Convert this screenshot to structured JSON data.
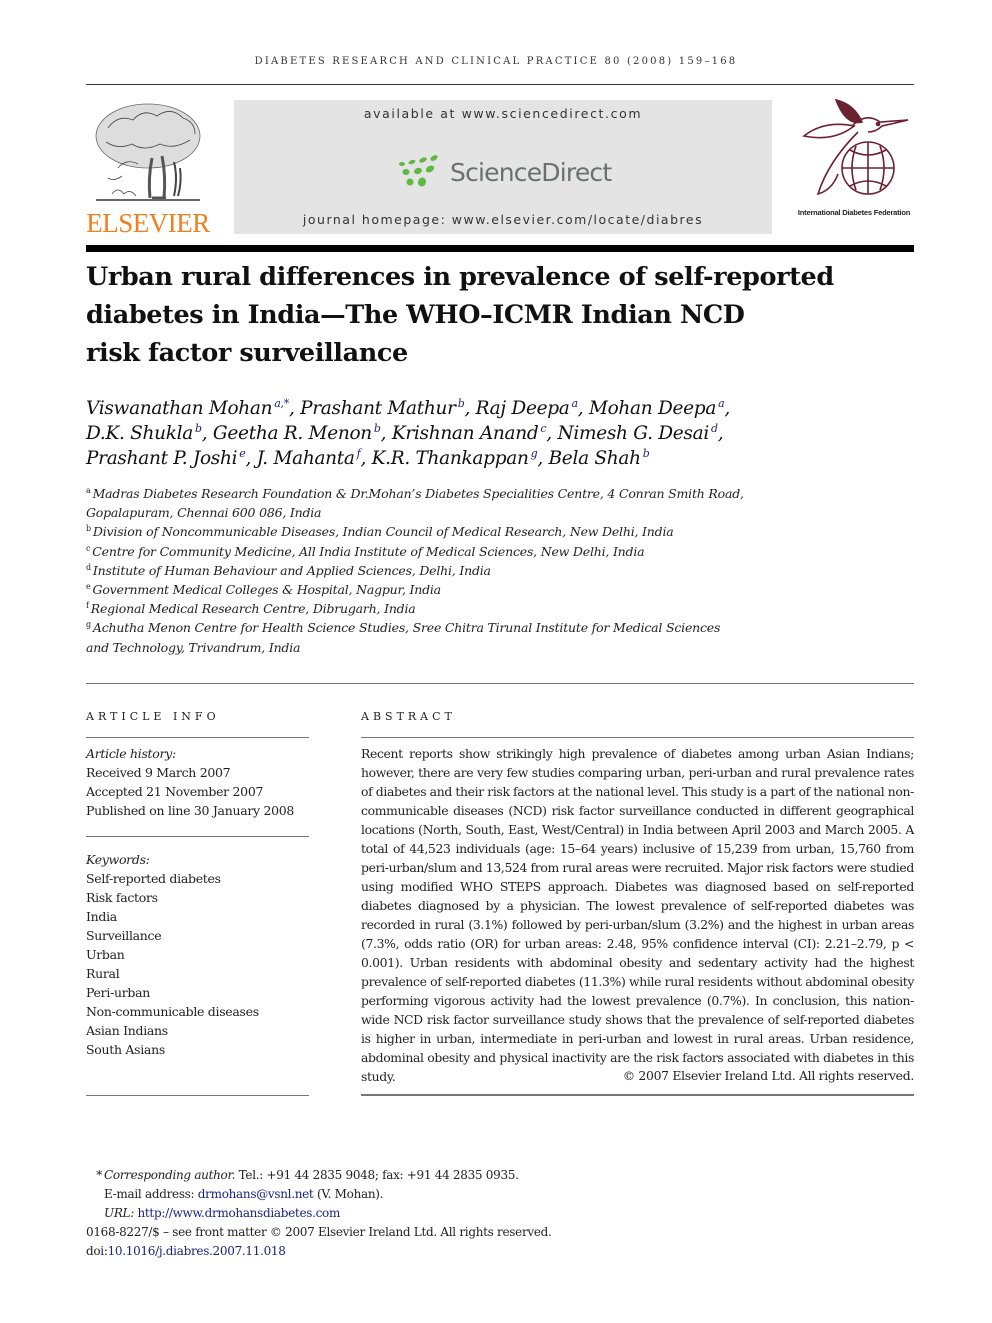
{
  "running_header": "DIABETES RESEARCH AND CLINICAL PRACTICE 80 (2008) 159–168",
  "banner": {
    "publisher_logo": "ELSEVIER",
    "available_at": "available at www.sciencedirect.com",
    "sciencedirect_logo": "ScienceDirect",
    "journal_homepage": "journal homepage: www.elsevier.com/locate/diabres",
    "society_label": "International Diabetes Federation",
    "colors": {
      "elsevier_orange": "#f07f1c",
      "sciencedirect_green": "#5fb840",
      "idf_maroon": "#6b2230"
    }
  },
  "title_lines": [
    "Urban rural differences in prevalence of self-reported",
    "diabetes in India—The WHO–ICMR Indian NCD",
    "risk factor surveillance"
  ],
  "authors": [
    {
      "name": "Viswanathan Mohan",
      "aff": "a,*"
    },
    {
      "name": "Prashant Mathur",
      "aff": "b"
    },
    {
      "name": "Raj Deepa",
      "aff": "a"
    },
    {
      "name": "Mohan Deepa",
      "aff": "a"
    },
    {
      "name": "D.K. Shukla",
      "aff": "b"
    },
    {
      "name": "Geetha R. Menon",
      "aff": "b"
    },
    {
      "name": "Krishnan Anand",
      "aff": "c"
    },
    {
      "name": "Nimesh G. Desai",
      "aff": "d"
    },
    {
      "name": "Prashant P. Joshi",
      "aff": "e"
    },
    {
      "name": "J. Mahanta",
      "aff": "f"
    },
    {
      "name": "K.R. Thankappan",
      "aff": "g"
    },
    {
      "name": "Bela Shah",
      "aff": "b"
    }
  ],
  "affiliations": [
    {
      "key": "a",
      "lines": [
        "Madras Diabetes Research Foundation & Dr.Mohan’s Diabetes Specialities Centre, 4 Conran Smith Road,",
        "Gopalapuram, Chennai 600 086, India"
      ]
    },
    {
      "key": "b",
      "lines": [
        "Division of Noncommunicable Diseases, Indian Council of Medical Research, New Delhi, India"
      ]
    },
    {
      "key": "c",
      "lines": [
        "Centre for Community Medicine, All India Institute of Medical Sciences, New Delhi, India"
      ]
    },
    {
      "key": "d",
      "lines": [
        "Institute of Human Behaviour and Applied Sciences, Delhi, India"
      ]
    },
    {
      "key": "e",
      "lines": [
        "Government Medical Colleges & Hospital, Nagpur, India"
      ]
    },
    {
      "key": "f",
      "lines": [
        "Regional Medical Research Centre, Dibrugarh, India"
      ]
    },
    {
      "key": "g",
      "lines": [
        "Achutha Menon Centre for Health Science Studies, Sree Chitra Tirunal Institute for Medical Sciences",
        "and Technology, Trivandrum, India"
      ]
    }
  ],
  "article_info": {
    "heading": "ARTICLE INFO",
    "history_label": "Article history:",
    "history": [
      "Received 9 March 2007",
      "Accepted 21 November 2007",
      "Published on line 30 January 2008"
    ],
    "keywords_label": "Keywords:",
    "keywords": [
      "Self-reported diabetes",
      "Risk factors",
      "India",
      "Surveillance",
      "Urban",
      "Rural",
      "Peri-urban",
      "Non-communicable diseases",
      "Asian Indians",
      "South Asians"
    ]
  },
  "abstract": {
    "heading": "ABSTRACT",
    "text": "Recent reports show strikingly high prevalence of diabetes among urban Asian Indians; however, there are very few studies comparing urban, peri-urban and rural prevalence rates of diabetes and their risk factors at the national level. This study is a part of the national non-communicable diseases (NCD) risk factor surveillance conducted in different geographical locations (North, South, East, West/Central) in India between April 2003 and March 2005. A total of 44,523 individuals (age: 15–64 years) inclusive of 15,239 from urban, 15,760 from peri-urban/slum and 13,524 from rural areas were recruited. Major risk factors were studied using modified WHO STEPS approach. Diabetes was diagnosed based on self-reported diabetes diagnosed by a physician. The lowest prevalence of self-reported diabetes was recorded in rural (3.1%) followed by peri-urban/slum (3.2%) and the highest in urban areas (7.3%, odds ratio (OR) for urban areas: 2.48, 95% confidence interval (CI): 2.21–2.79, p < 0.001). Urban residents with abdominal obesity and sedentary activity had the highest prevalence of self-reported diabetes (11.3%) while rural residents without abdominal obesity performing vigorous activity had the lowest prevalence (0.7%). In conclusion, this nation-wide NCD risk factor surveillance study shows that the prevalence of self-reported diabetes is higher in urban, intermediate in peri-urban and lowest in rural areas. Urban residence, abdominal obesity and physical inactivity are the risk factors associated with diabetes in this study.",
    "copyright": "© 2007 Elsevier Ireland Ltd. All rights reserved."
  },
  "footnotes": {
    "star": "*",
    "corresponding_label": "Corresponding author.",
    "corresponding_contact": " Tel.: +91 44 2835 9048; fax: +91 44 2835 0935.",
    "email_label": "E-mail address: ",
    "email": "drmohans@vsnl.net",
    "email_suffix": " (V. Mohan).",
    "url_label": "URL: ",
    "url": "http://www.drmohansdiabetes.com",
    "front_matter": "0168-8227/$ – see front matter © 2007 Elsevier Ireland Ltd. All rights reserved.",
    "doi_label": "doi:",
    "doi": "10.1016/j.diabres.2007.11.018"
  }
}
